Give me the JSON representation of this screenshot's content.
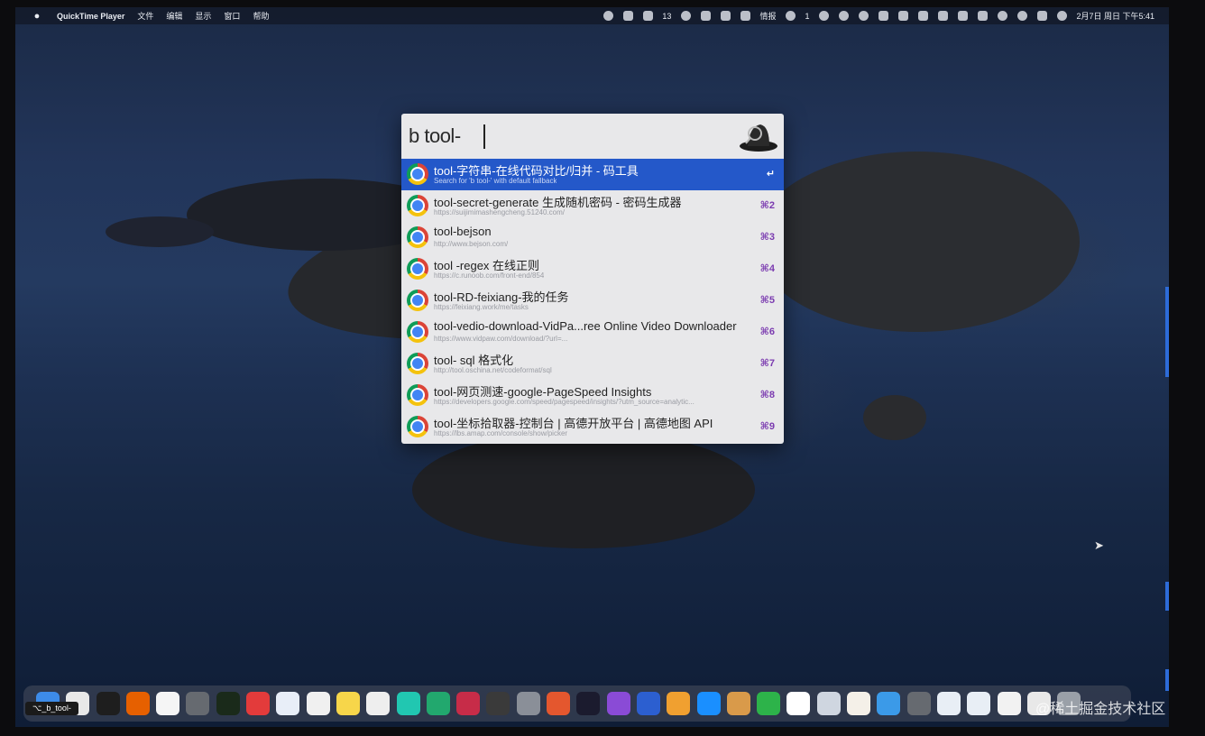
{
  "menubar": {
    "app_name": "QuickTime Player",
    "menus": [
      "文件",
      "编辑",
      "显示",
      "窗口",
      "帮助"
    ],
    "status_texts": [
      "13",
      "情报",
      "1"
    ],
    "clock": "2月7日 周日 下午5:41"
  },
  "alfred": {
    "query": "b tool-",
    "results": [
      {
        "title": "tool-字符串-在线代码对比/归并 - 码工具",
        "subtitle": "Search for 'b tool-' with default fallback",
        "shortcut": "↵"
      },
      {
        "title": "tool-secret-generate 生成随机密码 - 密码生成器",
        "subtitle": "https://suijimimashengcheng.51240.com/",
        "shortcut": "⌘2"
      },
      {
        "title": "tool-bejson",
        "subtitle": "http://www.bejson.com/",
        "shortcut": "⌘3"
      },
      {
        "title": "tool -regex 在线正则",
        "subtitle": "https://c.runoob.com/front-end/854",
        "shortcut": "⌘4"
      },
      {
        "title": "tool-RD-feixiang-我的任务",
        "subtitle": "https://feixiang.work/me/tasks",
        "shortcut": "⌘5"
      },
      {
        "title": "tool-vedio-download-VidPa...ree Online Video Downloader",
        "subtitle": "https://www.vidpaw.com/download/?url=...",
        "shortcut": "⌘6"
      },
      {
        "title": "tool- sql 格式化",
        "subtitle": "http://tool.oschina.net/codeformat/sql",
        "shortcut": "⌘7"
      },
      {
        "title": "tool-网页测速-google-PageSpeed Insights",
        "subtitle": "https://developers.google.com/speed/pagespeed/insights/?utm_source=analytic...",
        "shortcut": "⌘8"
      },
      {
        "title": "tool-坐标拾取器-控制台 | 高德开放平台 | 高德地图 API",
        "subtitle": "https://lbs.amap.com/console/show/picker",
        "shortcut": "⌘9"
      }
    ]
  },
  "dock": {
    "tooltip": "⌥_b_tool-",
    "icons": [
      "finder",
      "chrome",
      "terminal",
      "firefox",
      "calendar",
      "help",
      "iterm",
      "mail",
      "safari",
      "mosaic",
      "notes",
      "text-editor",
      "webstorm",
      "datagrip",
      "rubymine",
      "vpn",
      "settings",
      "paw",
      "intellij",
      "omnifocus",
      "qq-browser",
      "photos",
      "airmail",
      "nuts",
      "evernote",
      "reminders",
      "preview",
      "notes-pad",
      "folder",
      "help2",
      "window1",
      "window2",
      "window3",
      "window4",
      "trash"
    ],
    "icon_colors": [
      "#3d8be8",
      "#e8e8e8",
      "#1e1e1e",
      "#e66000",
      "#f5f5f5",
      "#666a70",
      "#1a2a1a",
      "#e33b3b",
      "#e8eef8",
      "#f0f0f0",
      "#f7d64a",
      "#eeeeee",
      "#21c7b1",
      "#22a86e",
      "#c72c48",
      "#3a3a3a",
      "#8a8f98",
      "#e4572e",
      "#1b1b2e",
      "#8a4bd6",
      "#2c5fd0",
      "#f0a030",
      "#1a8fff",
      "#d99a4a",
      "#2db34a",
      "#ffffff",
      "#cfd6e0",
      "#f4f0e8",
      "#3b9ae8",
      "#666a70",
      "#e8eef5",
      "#e8eef5",
      "#f2f2f2",
      "#e8e8e8",
      "#9aa0a8"
    ]
  },
  "watermark": "@稀土掘金技术社区"
}
